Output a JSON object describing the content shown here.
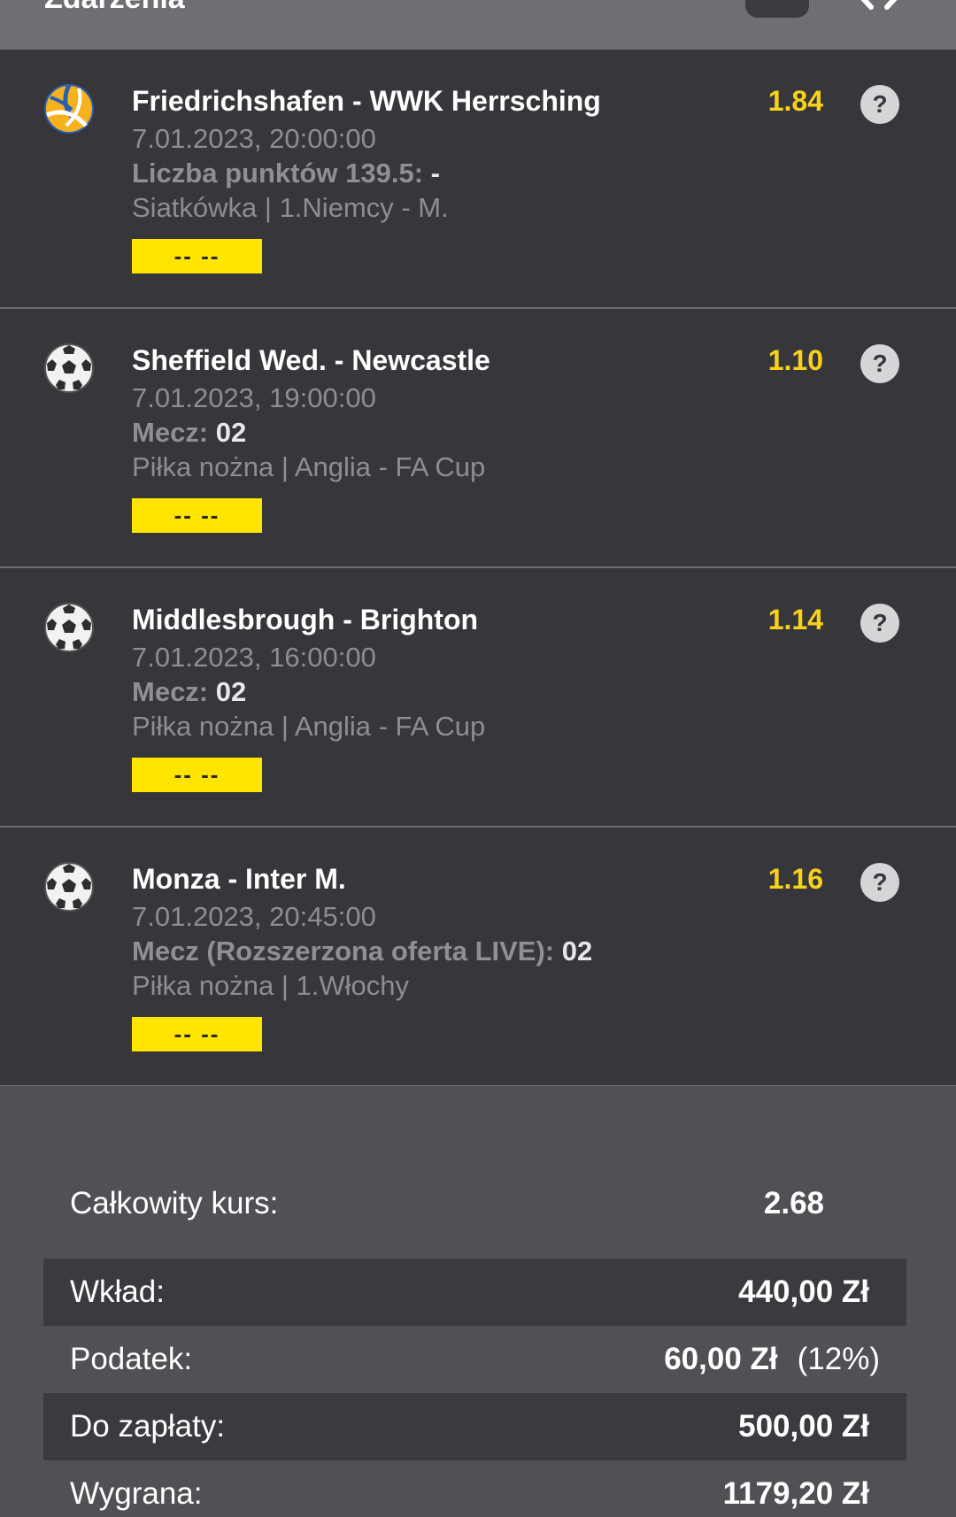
{
  "header": {
    "title": "Zdarzenia"
  },
  "events": [
    {
      "sport_icon": "volleyball-icon",
      "title": "Friedrichshafen - WWK Herrsching",
      "odds": "1.84",
      "date": "7.01.2023, 20:00:00",
      "market_label": "Liczba punktów 139.5: ",
      "market_pick": "-",
      "league": "Siatkówka | 1.Niemcy - M.",
      "status": "-- --",
      "help_label": "?"
    },
    {
      "sport_icon": "soccer-ball-icon",
      "title": "Sheffield Wed. - Newcastle",
      "odds": "1.10",
      "date": "7.01.2023, 19:00:00",
      "market_label": "Mecz: ",
      "market_pick": "02",
      "league": "Piłka nożna | Anglia - FA Cup",
      "status": "-- --",
      "help_label": "?"
    },
    {
      "sport_icon": "soccer-ball-icon",
      "title": "Middlesbrough - Brighton",
      "odds": "1.14",
      "date": "7.01.2023, 16:00:00",
      "market_label": "Mecz: ",
      "market_pick": "02",
      "league": "Piłka nożna | Anglia - FA Cup",
      "status": "-- --",
      "help_label": "?"
    },
    {
      "sport_icon": "soccer-ball-icon",
      "title": "Monza - Inter M.",
      "odds": "1.16",
      "date": "7.01.2023, 20:45:00",
      "market_label": "Mecz (Rozszerzona oferta LIVE): ",
      "market_pick": "02",
      "league": "Piłka nożna | 1.Włochy",
      "status": "-- --",
      "help_label": "?"
    }
  ],
  "summary": {
    "total_odds_label": "Całkowity kurs:",
    "total_odds_value": "2.68",
    "stake_label": "Wkład:",
    "stake_value": "440,00 Zł",
    "tax_label": "Podatek:",
    "tax_value": "60,00 Zł",
    "tax_percent": "(12%)",
    "to_pay_label": "Do zapłaty:",
    "to_pay_value": "500,00 Zł",
    "win_label": "Wygrana:",
    "win_value": "1179,20 Zł"
  },
  "colors": {
    "odds": "#f7d21b",
    "status_badge": "#ffe500",
    "event_bg": "#37373b",
    "summary_bg": "#515155"
  }
}
